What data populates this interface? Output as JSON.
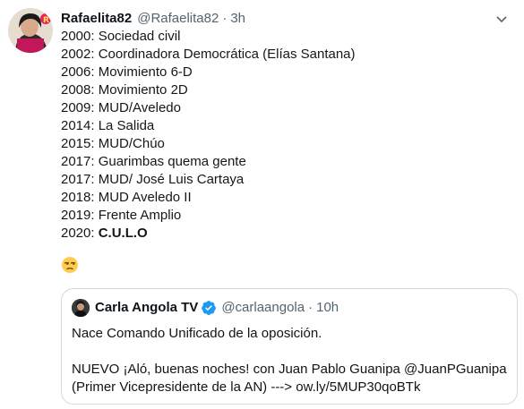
{
  "tweet": {
    "author_name": "Rafaelita82",
    "author_handle": "@Rafaelita82",
    "separator": "·",
    "time": "3h",
    "lines": [
      "2000: Sociedad civil",
      "2002: Coordinadora Democrática (Elías Santana)",
      "2006: Movimiento 6-D",
      "2008: Movimiento 2D",
      "2009: MUD/Aveledo",
      "2014: La Salida",
      "2015: MUD/Chúo",
      "2017: Guarimbas quema gente",
      "2017: MUD/ José Luis Cartaya",
      "2018: MUD Aveledo II",
      "2019: Frente Amplio"
    ],
    "last_line_prefix": "2020: ",
    "last_line_bold": "C.U.L.O",
    "emoji": "unamused-face-icon"
  },
  "quote": {
    "author_name": "Carla Angola TV",
    "author_handle": "@carlaangola",
    "separator": "·",
    "time": "10h",
    "line1": "Nace Comando Unificado de la oposición.",
    "line2": "NUEVO ¡Aló, buenas noches! con Juan Pablo Guanipa @JuanPGuanipa",
    "line3": "(Primer Vicepresidente de la AN) ---> ow.ly/5MUP30qoBTk"
  },
  "colors": {
    "text": "#0f1419",
    "secondary": "#536471",
    "border": "#cfd9de",
    "verified": "#1d9bf0"
  }
}
